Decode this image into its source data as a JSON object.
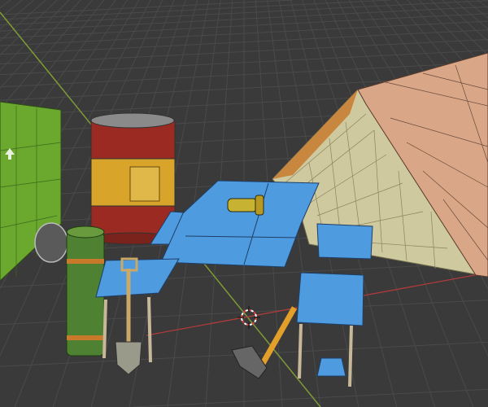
{
  "viewport": {
    "background": "#3a3a3a",
    "grid_color": "#4a4a4a",
    "x_axis_color": "#b03a3a",
    "y_axis_color": "#7f9a34"
  },
  "objects": {
    "dumpster": {
      "color": "#6aa82e"
    },
    "barrel": {
      "color_red": "#9a2a22",
      "color_yellow": "#d8a42a"
    },
    "sleeping_bag": {
      "color": "#4e8232"
    },
    "tent": {
      "roof_color": "#d9a788",
      "side_color": "#cfc9a0"
    },
    "table": {
      "color": "#4f9be0"
    },
    "shovel": {
      "color": "#c9a868"
    },
    "axe": {
      "color": "#e2a02a"
    },
    "lantern": {
      "color": "#c8b232"
    }
  }
}
